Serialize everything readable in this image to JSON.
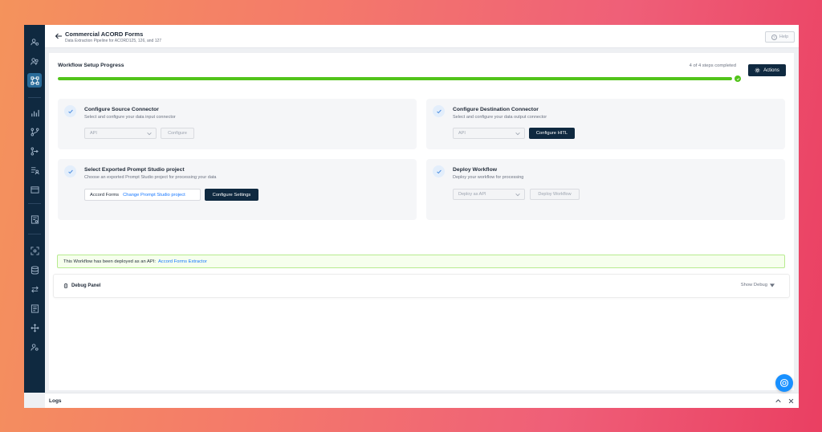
{
  "header": {
    "title": "Commercial ACORD Forms",
    "subtitle": "Data Extraction Pipeline for ACORD125, 126, and 127",
    "help_label": "Help"
  },
  "sidebar": {
    "items": [
      {
        "icon": "users-icon"
      },
      {
        "icon": "user-group-icon"
      },
      {
        "icon": "workflow-icon",
        "active": true
      },
      {
        "icon": "bar-chart-icon"
      },
      {
        "icon": "git-branch-icon"
      },
      {
        "icon": "pipeline-icon"
      },
      {
        "icon": "list-user-icon"
      },
      {
        "icon": "window-icon"
      },
      {
        "icon": "document-settings-icon"
      },
      {
        "icon": "scan-icon"
      },
      {
        "icon": "database-icon"
      },
      {
        "icon": "swap-icon"
      },
      {
        "icon": "list-settings-icon"
      },
      {
        "icon": "move-icon"
      },
      {
        "icon": "user-settings-icon"
      }
    ]
  },
  "progress": {
    "title": "Workflow Setup Progress",
    "steps_text": "4 of 4 steps completed",
    "completed": 4,
    "total": 4,
    "actions_label": "Actions",
    "bar_color": "#52c41a"
  },
  "cards": {
    "source": {
      "title": "Configure Source Connector",
      "description": "Select and configure your data input connector",
      "select_value": "API",
      "button_label": "Configure"
    },
    "destination": {
      "title": "Configure Destination Connector",
      "description": "Select and configure your data output connector",
      "select_value": "API",
      "button_label": "Configure HITL"
    },
    "project": {
      "title": "Select Exported Prompt Studio project",
      "description": "Choose an exported Prompt Studio project for processing your data",
      "project_name": "Accord Forms",
      "change_label": "Change Prompt Studio project",
      "button_label": "Configure Settings"
    },
    "deploy": {
      "title": "Deploy Workflow",
      "description": "Deploy your workflow for processing",
      "select_value": "Deploy as API",
      "button_label": "Deploy Workflow"
    }
  },
  "alert": {
    "text": "This Workflow has been deployed as an API:",
    "link": "Accord Forms Extractor"
  },
  "debug": {
    "title": "Debug Panel",
    "toggle_label": "Show Debug"
  },
  "logs": {
    "title": "Logs"
  },
  "colors": {
    "sidebar": "#0f2940",
    "primary_dark": "#0f2940",
    "link": "#1677ff",
    "success": "#52c41a",
    "fab": "#1890ff"
  }
}
